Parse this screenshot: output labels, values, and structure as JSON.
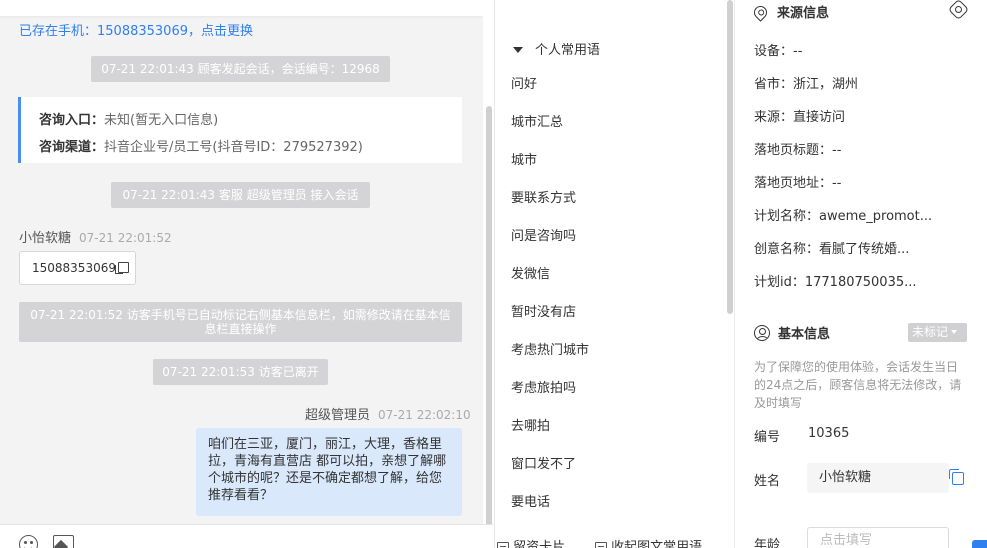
{
  "chat": {
    "phone_notice": "已存在手机：15088353069，点击更换",
    "sys_start": "07-21 22:01:43 顾客发起会话，会话编号：12968",
    "consult_entry_label": "咨询入口：",
    "consult_entry_value": "未知(暂无入口信息)",
    "consult_channel_label": "咨询渠道：",
    "consult_channel_value": "抖音企业号/员工号(抖音号ID：279527392)",
    "sys_join": "07-21 22:01:43 客服 超级管理员 接入会话",
    "visitor_name": "小怡软糖",
    "visitor_time": "07-21 22:01:52",
    "visitor_phone": "15088353069",
    "sys_marked": "07-21 22:01:52 访客手机号已自动标记右侧基本信息栏，如需修改请在基本信息栏直接操作",
    "sys_left": "07-21 22:01:53 访客已离开",
    "agent_name": "超级管理员",
    "agent_time": "07-21 22:02:10",
    "agent_message": "咱们在三亚，厦门，丽江，大理，香格里拉，青海有直营店 都可以拍，亲想了解哪个城市的呢？还是不确定都想了解，给您推荐看看？"
  },
  "phrases": {
    "group_title": "个人常用语",
    "items": [
      "问好",
      "城市汇总",
      "城市",
      "要联系方式",
      "问是咨询吗",
      "发微信",
      "暂时没有店",
      "考虑热门城市",
      "考虑旅拍吗",
      "去哪拍",
      "窗口发不了",
      "要电话"
    ],
    "bottom_left": "留资卡片",
    "bottom_right": "收起图文常用语"
  },
  "info": {
    "source_title": "来源信息",
    "source_rows": [
      "设备：--",
      "省市：浙江，湖州",
      "来源：直接访问",
      "落地页标题：--",
      "落地页地址：--",
      "计划名称：aweme_promot...",
      "创意名称：看腻了传统婚...",
      "计划id：177180750035..."
    ],
    "basic_title": "基本信息",
    "mark_label": "未标记",
    "notice": "为了保障您的使用体验，会话发生当日的24点之后，顾客信息将无法修改，请及时填写",
    "id_label": "编号",
    "id_value": "10365",
    "name_label": "姓名",
    "name_value": "小怡软糖",
    "age_label": "年龄",
    "age_placeholder": "点击填写"
  }
}
